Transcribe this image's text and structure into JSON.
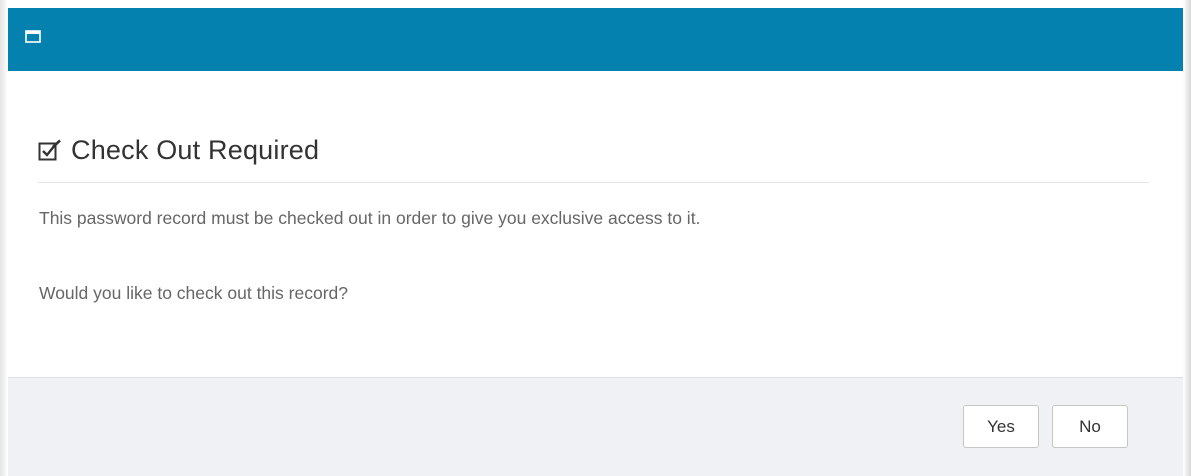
{
  "window": {
    "icon": "window-icon",
    "titlebar_color": "#0581b0"
  },
  "dialog": {
    "icon": "checkbox-edit-icon",
    "title": "Check Out Required",
    "message": "This password record must be checked out in order to give you exclusive access to it.",
    "question": "Would you like to check out this record?"
  },
  "buttons": {
    "yes_label": "Yes",
    "no_label": "No"
  }
}
